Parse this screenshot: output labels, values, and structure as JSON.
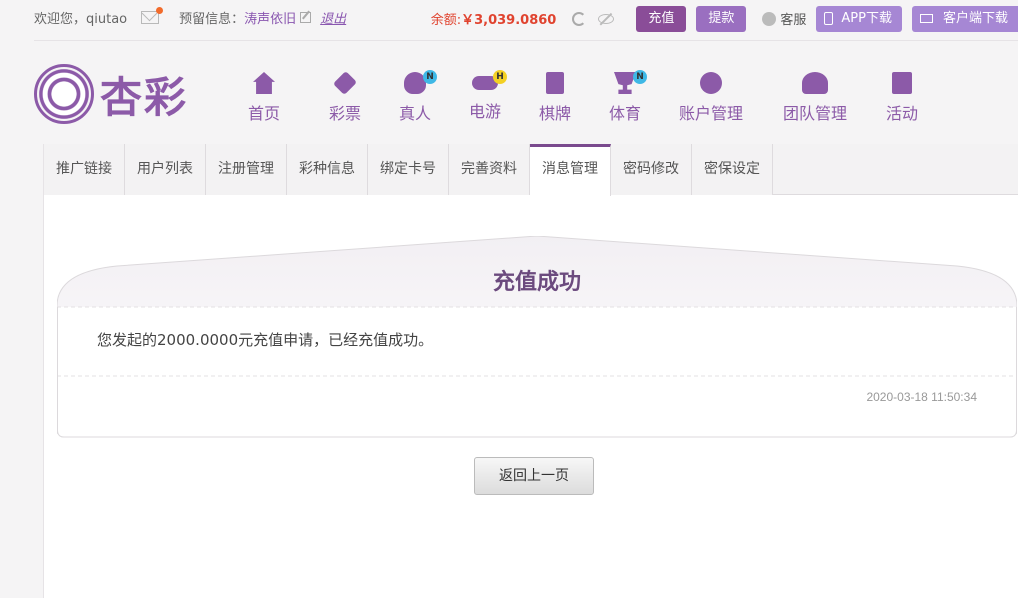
{
  "topbar": {
    "welcome": "欢迎您，qiutao",
    "reserved_label": "预留信息：",
    "reserved_value": "涛声依旧",
    "logout": "退出",
    "balance_label": "余额:",
    "balance_value": "￥3,039.0860",
    "recharge": "充值",
    "withdraw": "提款",
    "service": "客服",
    "app_download": "APP下载",
    "client_download": "客户端下载"
  },
  "logo": {
    "text": "杏彩"
  },
  "nav": [
    {
      "label": "首页",
      "icon": "home-icon",
      "badge": ""
    },
    {
      "label": "彩票",
      "icon": "lottery-ticket-icon",
      "badge": ""
    },
    {
      "label": "真人",
      "icon": "live-dealer-icon",
      "badge": "N"
    },
    {
      "label": "电游",
      "icon": "gamepad-icon",
      "badge": "H"
    },
    {
      "label": "棋牌",
      "icon": "playing-cards-icon",
      "badge": ""
    },
    {
      "label": "体育",
      "icon": "trophy-icon",
      "badge": "N"
    },
    {
      "label": "账户管理",
      "icon": "coin-icon",
      "badge": ""
    },
    {
      "label": "团队管理",
      "icon": "team-icon",
      "badge": ""
    },
    {
      "label": "活动",
      "icon": "gift-icon",
      "badge": ""
    }
  ],
  "tabs": [
    {
      "label": "推广链接",
      "active": false
    },
    {
      "label": "用户列表",
      "active": false
    },
    {
      "label": "注册管理",
      "active": false
    },
    {
      "label": "彩种信息",
      "active": false
    },
    {
      "label": "绑定卡号",
      "active": false
    },
    {
      "label": "完善资料",
      "active": false
    },
    {
      "label": "消息管理",
      "active": true
    },
    {
      "label": "密码修改",
      "active": false
    },
    {
      "label": "密保设定",
      "active": false
    }
  ],
  "message": {
    "title": "充值成功",
    "body": "您发起的2000.0000元充值申请，已经充值成功。",
    "time": "2020-03-18 11:50:34"
  },
  "back_button": "返回上一页",
  "colors": {
    "brand": "#8c5aa8",
    "recharge_button": "#8a4d98",
    "withdraw_button": "#9a6fc0",
    "download_button": "#a687d4",
    "balance": "#e0432f",
    "notification_dot": "#f26b2b"
  }
}
